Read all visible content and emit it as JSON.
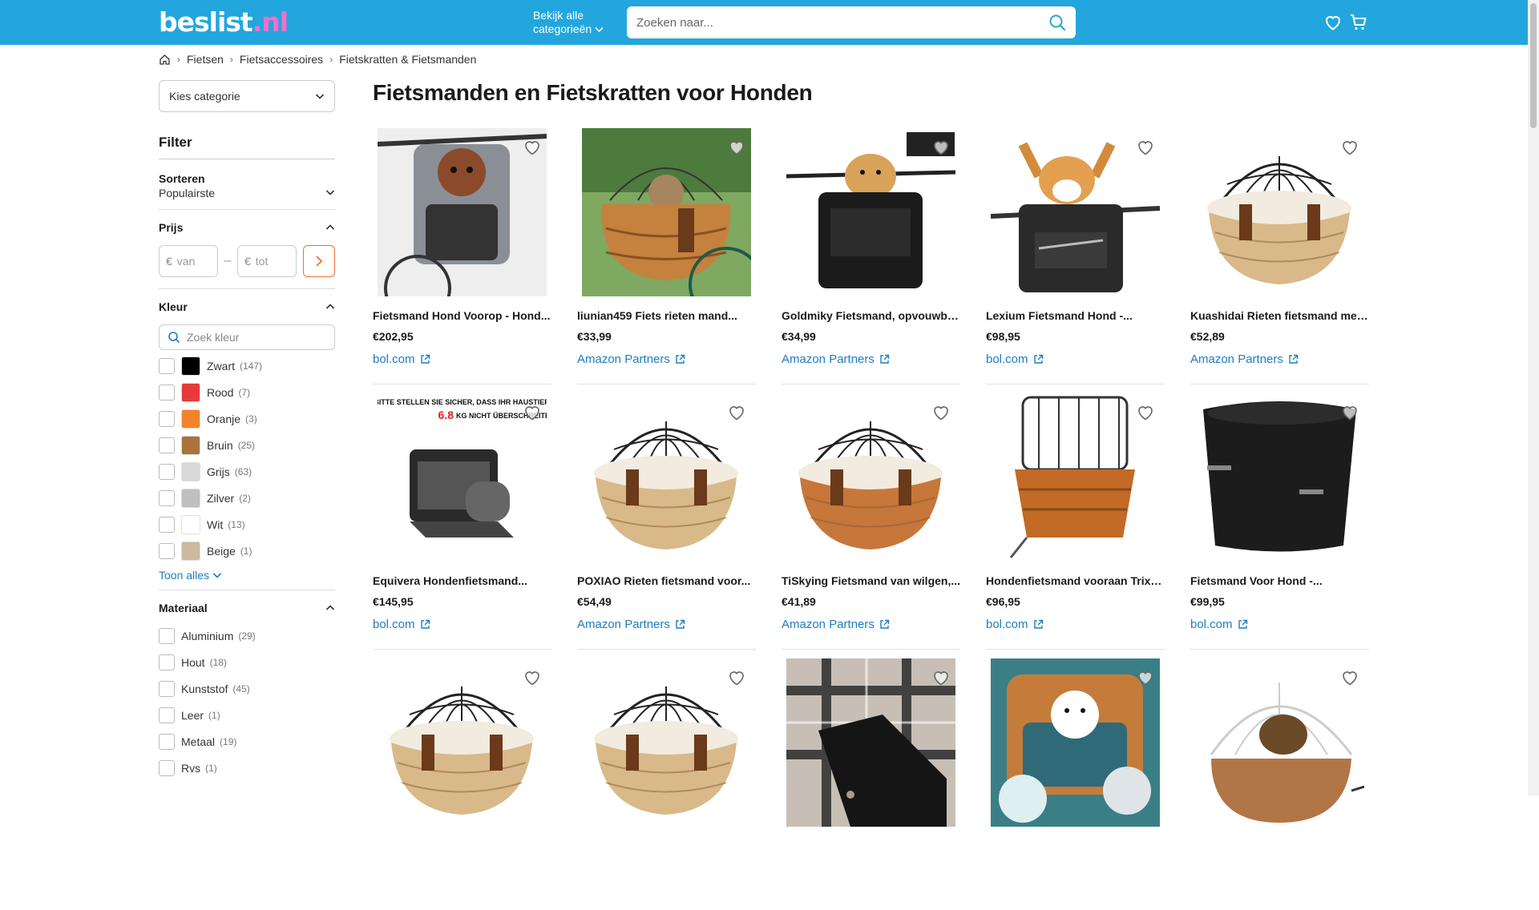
{
  "header": {
    "logo_main": "beslist",
    "logo_ext": ".nl",
    "categories_line1": "Bekijk alle",
    "categories_line2": "categorieën",
    "search_placeholder": "Zoeken naar..."
  },
  "breadcrumb": [
    "Fietsen",
    "Fietsaccessoires",
    "Fietskratten & Fietsmanden"
  ],
  "sidebar": {
    "category_select": "Kies categorie",
    "filter_title": "Filter",
    "sort": {
      "label": "Sorteren",
      "value": "Populairste"
    },
    "price": {
      "label": "Prijs",
      "currency": "€",
      "from_placeholder": "van",
      "to_placeholder": "tot"
    },
    "color": {
      "label": "Kleur",
      "search_placeholder": "Zoek kleur",
      "options": [
        {
          "name": "Zwart",
          "count": "(147)",
          "hex": "#000000"
        },
        {
          "name": "Rood",
          "count": "(7)",
          "hex": "#e83a3a"
        },
        {
          "name": "Oranje",
          "count": "(3)",
          "hex": "#f5822a"
        },
        {
          "name": "Bruin",
          "count": "(25)",
          "hex": "#a9743c"
        },
        {
          "name": "Grijs",
          "count": "(63)",
          "hex": "#d9d9d9"
        },
        {
          "name": "Zilver",
          "count": "(2)",
          "hex": "#bfbfbf"
        },
        {
          "name": "Wit",
          "count": "(13)",
          "hex": "#ffffff"
        },
        {
          "name": "Beige",
          "count": "(1)",
          "hex": "#cdb8a0"
        }
      ],
      "show_all": "Toon alles"
    },
    "material": {
      "label": "Materiaal",
      "options": [
        {
          "name": "Aluminium",
          "count": "(29)"
        },
        {
          "name": "Hout",
          "count": "(18)"
        },
        {
          "name": "Kunststof",
          "count": "(45)"
        },
        {
          "name": "Leer",
          "count": "(1)"
        },
        {
          "name": "Metaal",
          "count": "(19)"
        },
        {
          "name": "Rvs",
          "count": "(1)"
        }
      ]
    }
  },
  "main": {
    "title": "Fietsmanden en Fietskratten voor Honden",
    "products": [
      {
        "title": "Fietsmand Hond Voorop - Hond...",
        "price": "€202,95",
        "shop": "bol.com",
        "img": "grey-carrier"
      },
      {
        "title": "liunian459 Fiets rieten mand...",
        "price": "€33,99",
        "shop": "Amazon Partners",
        "img": "wicker-cat"
      },
      {
        "title": "Goldmiky Fietsmand, opvouwba...",
        "price": "€34,99",
        "shop": "Amazon Partners",
        "img": "black-bag-dog"
      },
      {
        "title": "Lexium Fietsmand Hond -...",
        "price": "€98,95",
        "shop": "bol.com",
        "img": "black-bag-corgi"
      },
      {
        "title": "Kuashidai Rieten fietsmand met...",
        "price": "€52,89",
        "shop": "Amazon Partners",
        "img": "wicker-cage"
      },
      {
        "title": "Equivera Hondenfietsmand...",
        "price": "€145,95",
        "shop": "bol.com",
        "img": "black-carrier-diagram"
      },
      {
        "title": "POXIAO Rieten fietsmand voor...",
        "price": "€54,49",
        "shop": "Amazon Partners",
        "img": "wicker-cage"
      },
      {
        "title": "TiSkying Fietsmand van wilgen,...",
        "price": "€41,89",
        "shop": "Amazon Partners",
        "img": "wicker-cage-dark"
      },
      {
        "title": "Hondenfietsmand vooraan Trixie...",
        "price": "€96,95",
        "shop": "bol.com",
        "img": "orange-wicker-cage"
      },
      {
        "title": "Fietsmand Voor Hond -...",
        "price": "€99,95",
        "shop": "bol.com",
        "img": "black-basket"
      },
      {
        "title": "",
        "price": "",
        "shop": "",
        "img": "wicker-cage"
      },
      {
        "title": "",
        "price": "",
        "shop": "",
        "img": "wicker-cage"
      },
      {
        "title": "",
        "price": "",
        "shop": "",
        "img": "plaid"
      },
      {
        "title": "",
        "price": "",
        "shop": "",
        "img": "teal-collage"
      },
      {
        "title": "",
        "price": "",
        "shop": "",
        "img": "white-cage"
      }
    ],
    "banner_text_line1": "BITTE STELLEN SIE SICHER, DASS IHR HAUSTIER",
    "banner_text_line2": "6.8",
    "banner_text_line3": "KG NICHT ÜBERSCHREITET"
  },
  "colors": {
    "brand": "#23a6dd",
    "link": "#1e7dc1",
    "accent": "#f07030",
    "logo_ext": "#ff6cc9"
  }
}
